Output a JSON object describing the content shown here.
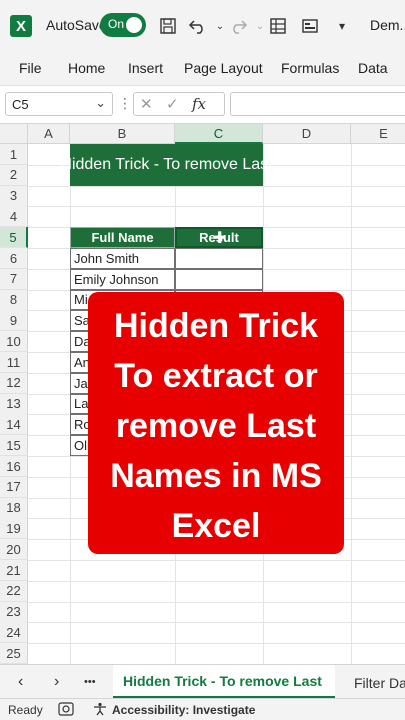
{
  "titlebar": {
    "logo": "X",
    "autosave_label": "AutoSave",
    "toggle_state": "On",
    "doc_name": "Dem..."
  },
  "icons": {
    "save": "save-icon",
    "undo": "undo-icon",
    "redo": "redo-icon",
    "form": "form-icon",
    "view": "view-icon",
    "more": "dropdown-icon"
  },
  "ribbon": {
    "tabs": [
      "File",
      "Home",
      "Insert",
      "Page Layout",
      "Formulas",
      "Data"
    ]
  },
  "formula_bar": {
    "name_box": "C5",
    "separator": "⋮",
    "cancel": "✕",
    "enter": "✓",
    "fx": "fx",
    "value": ""
  },
  "grid": {
    "columns": [
      "A",
      "B",
      "C",
      "D",
      "E"
    ],
    "rows": [
      "1",
      "2",
      "3",
      "4",
      "5",
      "6",
      "7",
      "8",
      "9",
      "10",
      "11",
      "12",
      "13",
      "14",
      "15",
      "16",
      "17",
      "18",
      "19",
      "20",
      "21",
      "22",
      "23",
      "24",
      "25"
    ],
    "selected_col": "C",
    "selected_row": "5",
    "title": "Hidden Trick - To remove Last",
    "header_full_name": "Full Name",
    "header_result": "Result",
    "names": [
      "John Smith",
      "Emily Johnson",
      "Mi",
      "Sa",
      "Da",
      "An",
      "Jar",
      "Lau",
      "Ro",
      "Oli"
    ]
  },
  "overlay": {
    "lines": [
      "Hidden Trick",
      "To extract or",
      "remove Last",
      "Names in MS",
      "Excel"
    ],
    "color": "#e60000"
  },
  "sheets": {
    "prev": "‹",
    "next": "›",
    "more": "•••",
    "active": "Hidden Trick - To remove Last",
    "other": "Filter Da"
  },
  "status": {
    "ready": "Ready",
    "accessibility": "Accessibility: Investigate"
  },
  "colors": {
    "excel_green": "#107c41",
    "header_green": "#1e6e3a"
  }
}
